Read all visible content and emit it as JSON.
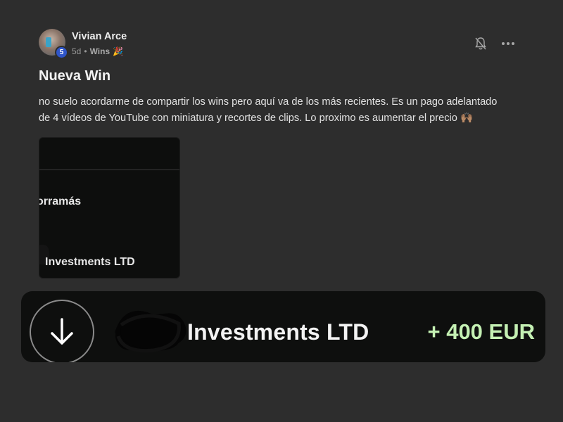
{
  "author": {
    "name": "Vivian Arce",
    "level": "5",
    "time": "5d",
    "separator": "•",
    "category": "Wins",
    "category_emoji": "🎉"
  },
  "post": {
    "title": "Nueva Win",
    "body_lines": [
      "no suelo acordarme de compartir los wins pero aquí va de los más recientes. Es un pago adelantado",
      "de 4 vídeos de YouTube con miniatura y recortes de clips. Lo proximo es aumentar el precio 🙌🏽"
    ]
  },
  "attachment": {
    "label_top": "orramás",
    "label_bottom": "Investments LTD"
  },
  "payment": {
    "company": "Investments LTD",
    "amount": "+ 400 EUR"
  },
  "icons": {
    "notifications": "bell-off-icon",
    "more": "more-horizontal-icon",
    "incoming": "arrow-down-icon"
  },
  "colors": {
    "background": "#2d2d2d",
    "level_badge": "#2f55c8",
    "amount": "#c4f0b3",
    "banner": "#0e0f0e"
  }
}
